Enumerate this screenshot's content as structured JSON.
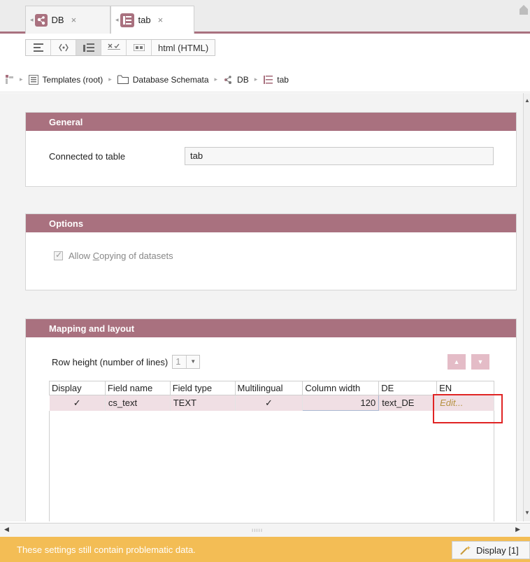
{
  "tabs": [
    {
      "label": "DB",
      "close": "×"
    },
    {
      "label": "tab",
      "close": "×"
    }
  ],
  "viewbar": {
    "html_label": "html (HTML)"
  },
  "breadcrumb": [
    {
      "label": "Templates (root)",
      "icon": "templates-icon"
    },
    {
      "label": "Database Schemata",
      "icon": "folder-icon"
    },
    {
      "label": "DB",
      "icon": "db-icon"
    },
    {
      "label": "tab",
      "icon": "table-icon"
    }
  ],
  "general": {
    "title": "General",
    "connected_label": "Connected to table",
    "connected_value": "tab"
  },
  "options": {
    "title": "Options",
    "allow_copy_prefix": "Allow ",
    "allow_copy_mnemonic": "C",
    "allow_copy_suffix": "opying of datasets",
    "allow_copy_checked": true
  },
  "mapping": {
    "title": "Mapping and layout",
    "row_height_label": "Row height (number of lines)",
    "row_height_value": "1",
    "columns": [
      "Display",
      "Field name",
      "Field type",
      "Multilingual",
      "Column width",
      "DE",
      "EN"
    ],
    "rows": [
      {
        "display": "✓",
        "field_name": "cs_text",
        "field_type": "TEXT",
        "multilingual": "✓",
        "column_width": "120",
        "de": "text_DE",
        "en": "Edit..."
      }
    ]
  },
  "status": {
    "message": "These settings still contain problematic data.",
    "display_button": "Display [1]"
  },
  "colors": {
    "accent": "#a9717f",
    "status_bar": "#f3bd55",
    "edit_cell": "#f3c562",
    "highlight": "#e02424"
  }
}
